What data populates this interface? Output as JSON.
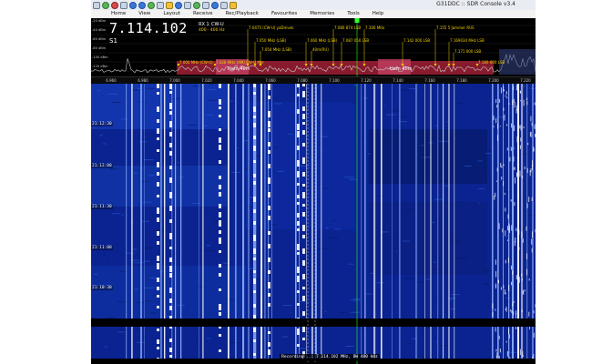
{
  "app": {
    "title": "G31DDC :: SDR Console v3.4"
  },
  "menu": [
    "Home",
    "View",
    "Layout",
    "Receive",
    "Rec/Playback",
    "Favourites",
    "Memories",
    "Tools",
    "Help"
  ],
  "receiver": {
    "frequency": "7.114.102",
    "rx": "RX 1",
    "mode": "CW-U",
    "bandwidth": "400 · 400 Hz",
    "smeter": "S1"
  },
  "spectrum": {
    "db_labels": [
      "-20 dBm",
      "-40 dBm",
      "-60 dBm",
      "-80 dBm",
      "-100 dBm",
      "-120 dBm"
    ],
    "freq_labels": [
      "7.000 MHz (CW-U)",
      "7.0475 (CW-U) yaDmvek",
      "7.050 MHz (LSB)",
      "7.054 MHz (LSB)",
      "7.060 MHz (LSB)",
      "7.080 874 LSB",
      "7.087 050 LSB",
      "7.100 MHz",
      "7.142 000 LSB",
      "7.155 5 Jammer RUS",
      "7.169034 MHz LSB",
      "7.171 000 LSB",
      "7.180 000 LSB",
      "7.028 MHz (AM) CW-U Mer",
      "40m(RU)"
    ],
    "band_labels": [
      "Ham 40m",
      "Ham 40m"
    ]
  },
  "scale": {
    "ticks": [
      "6.960",
      "6.980",
      "7.000",
      "7.020",
      "7.040",
      "7.060",
      "7.080",
      "7.100",
      "7.120",
      "7.140",
      "7.160",
      "7.180",
      "7.200",
      "7.220"
    ]
  },
  "waterfall": {
    "timestamps": [
      "21:12:30",
      "21:12:00",
      "21:11:30",
      "21:11:00",
      "21:10:30"
    ]
  },
  "status": {
    "text": "Recording ..: 7.114.102 MHz, BW 400 kHz"
  },
  "colors": {
    "accent": "#f0d000",
    "marker": "#27ff27",
    "band": "#a01e35",
    "waterfall": "#0b2fb0"
  }
}
